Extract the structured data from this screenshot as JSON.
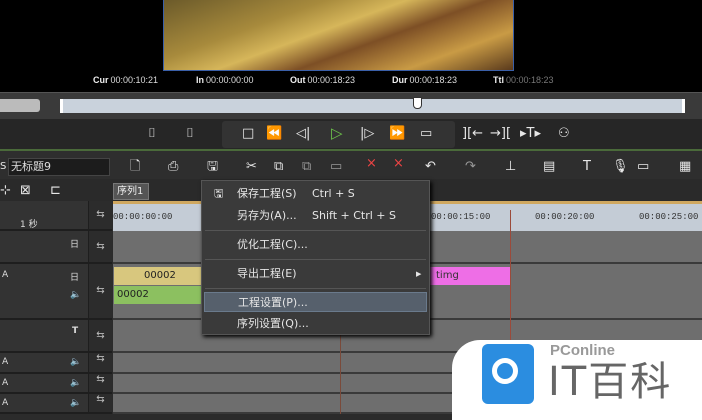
{
  "timecodes": {
    "cur_label": "Cur",
    "cur": "00:00:10:21",
    "in_label": "In",
    "in": "00:00:00:00",
    "out_label": "Out",
    "out": "00:00:18:23",
    "dur_label": "Dur",
    "dur": "00:00:18:23",
    "ttl_label": "Ttl",
    "ttl": "00:00:18:23"
  },
  "project": {
    "title": "无标题9",
    "sequence_tab": "序列1",
    "scale": "1 秒"
  },
  "ruler": [
    "00:00:00:00",
    "00:00:15:00",
    "00:00:20:00",
    "00:00:25:00"
  ],
  "clips": {
    "video_clip": "00002",
    "audio_clip": "00002",
    "pink_clip": "timg"
  },
  "menu": {
    "items": [
      {
        "label": "保存工程(S)",
        "shortcut": "Ctrl + S"
      },
      {
        "label": "另存为(A)...",
        "shortcut": "Shift + Ctrl + S"
      },
      {
        "label": "优化工程(C)..."
      },
      {
        "label": "导出工程(E)"
      },
      {
        "label": "工程设置(P)..."
      },
      {
        "label": "序列设置(Q)..."
      }
    ]
  },
  "tracks": {
    "a_label": "A",
    "t_label": "T"
  },
  "watermark": {
    "brand": "PConline",
    "name": "IT百科"
  },
  "colors": {
    "play": "#6cc04a",
    "clip_yellow": "#d8c77e",
    "clip_green": "#8cc060",
    "clip_pink": "#ee6ee6",
    "menu_highlight": "#56606c"
  }
}
